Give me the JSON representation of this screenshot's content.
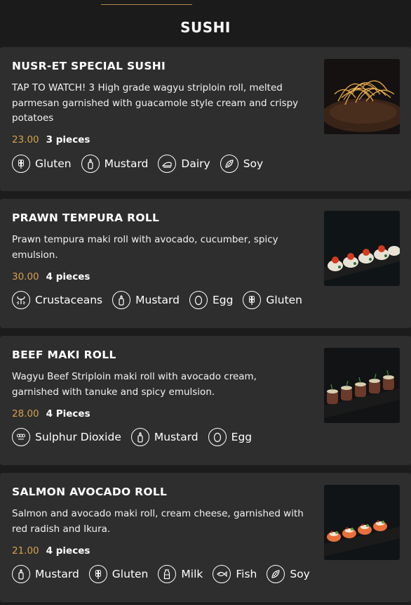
{
  "header": {
    "title": "SUSHI"
  },
  "items": [
    {
      "name": "NUSR-ET SPECIAL SUSHI",
      "description": "TAP TO WATCH! 3 High grade wagyu striploin roll, melted parmesan garnished with guacamole style cream and crispy potatoes",
      "price": "23.00",
      "pieces": "3 pieces",
      "allergens": [
        {
          "label": "Gluten",
          "icon": "wheat-icon"
        },
        {
          "label": "Mustard",
          "icon": "mustard-bottle-icon"
        },
        {
          "label": "Dairy",
          "icon": "dairy-icon"
        },
        {
          "label": "Soy",
          "icon": "soy-icon"
        }
      ],
      "image": "sushi-with-crispy-potatoes-photo"
    },
    {
      "name": "PRAWN TEMPURA ROLL",
      "description": "Prawn tempura maki roll with avocado, cucumber, spicy emulsion.",
      "price": "30.00",
      "pieces": "4 pieces",
      "allergens": [
        {
          "label": "Crustaceans",
          "icon": "crustacean-icon"
        },
        {
          "label": "Mustard",
          "icon": "mustard-bottle-icon"
        },
        {
          "label": "Egg",
          "icon": "egg-icon"
        },
        {
          "label": "Gluten",
          "icon": "wheat-icon"
        }
      ],
      "image": "prawn-tempura-roll-photo"
    },
    {
      "name": "BEEF MAKI ROLL",
      "description": "Wagyu Beef Striploin maki roll with avocado cream, garnished with tanuke and spicy emulsion.",
      "price": "28.00",
      "pieces": "4 Pieces",
      "allergens": [
        {
          "label": "Sulphur Dioxide",
          "icon": "sulphur-dioxide-icon"
        },
        {
          "label": "Mustard",
          "icon": "mustard-bottle-icon"
        },
        {
          "label": "Egg",
          "icon": "egg-icon"
        }
      ],
      "image": "beef-maki-roll-photo"
    },
    {
      "name": "SALMON AVOCADO ROLL",
      "description": "Salmon and avocado maki roll, cream cheese, garnished with red radish and Ikura.",
      "price": "21.00",
      "pieces": "4 pieces",
      "allergens": [
        {
          "label": "Mustard",
          "icon": "mustard-bottle-icon"
        },
        {
          "label": "Gluten",
          "icon": "wheat-icon"
        },
        {
          "label": "Milk",
          "icon": "milk-bottle-icon"
        },
        {
          "label": "Fish",
          "icon": "fish-icon"
        },
        {
          "label": "Soy",
          "icon": "soy-icon"
        }
      ],
      "image": "salmon-avocado-roll-photo"
    }
  ],
  "colors": {
    "background": "#1c1c1c",
    "card": "#2e2e2e",
    "price": "#d4a24c",
    "header_accent": "#b08a4a"
  }
}
